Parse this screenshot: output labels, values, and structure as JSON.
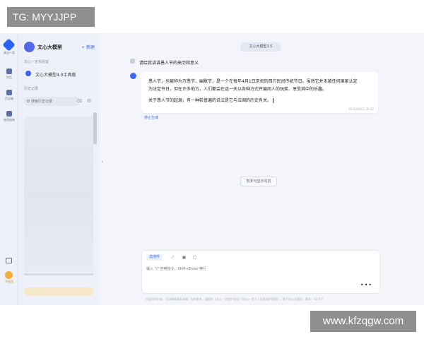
{
  "watermark_top": "TG: MYYJJPP",
  "watermark_bottom": "www.kfzqgw.com",
  "rail": {
    "logo_label": "文心一言",
    "items": [
      {
        "label": "对话"
      },
      {
        "label": "百宝箱"
      },
      {
        "label": "使用指南"
      }
    ],
    "vip_label": "开会员"
  },
  "sidebar": {
    "title": "文心大模型",
    "new_label": "+ 新建",
    "section_tools": "文心一言实验室",
    "tool_label": "文心大模型4.0工具版",
    "section_history": "历史记录",
    "search_placeholder": "搜索历史记录"
  },
  "main": {
    "model_pill": "文心大模型3.5",
    "user_message": "请给我讲讲愚人节的来历和意义",
    "bot_lines": [
      "愚人节，也被称为万愚节、幽默节，是一个在每年4月1日庆祝的西方民间传统节日。虽然它并未被任何国家认定",
      "为法定节日，但在许多地方，人们都会在这一天以各种方式开展闹人的玩笑、享受其中的乐趣。",
      "关于愚人节的起源，有一种较普遍的说法是它与法国的历史有关。"
    ],
    "bot_time": "2024/04/01 09:32",
    "stop_label": "停止生成",
    "center_badge": "暂未可显示内容",
    "input_chip": "选插件",
    "input_placeholder": "输入 \"/\" 召唤指令，Shift+Enter 换行",
    "footer_note": "内容由AI生成，无法确保真实准确，仅供参考，请遵守《文心一言用户协议》《文心一言个人信息保护规则》，基于文心大模型，版本：V2.5.0"
  }
}
